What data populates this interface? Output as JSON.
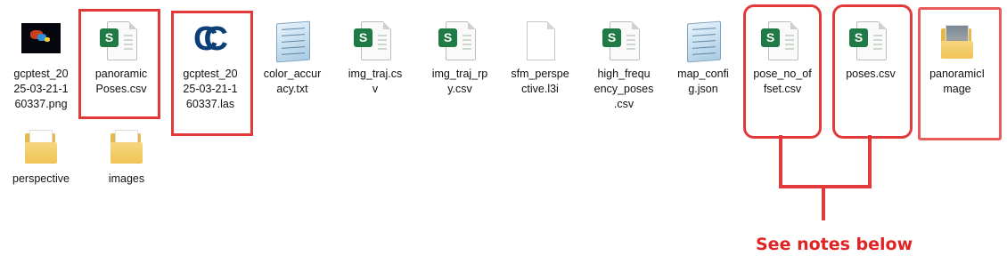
{
  "files": [
    {
      "name": "gcptest_2025-03-21-160337.png",
      "label_lines": [
        "gcptest_20",
        "25-03-21-1",
        "60337.png"
      ],
      "icon": "image-thumbnail-icon"
    },
    {
      "name": "panoramicPoses.csv",
      "label_lines": [
        "panoramic",
        "Poses.csv"
      ],
      "icon": "csv-icon"
    },
    {
      "name": "gcptest_2025-03-21-160337.las",
      "label_lines": [
        "gcptest_20",
        "25-03-21-1",
        "60337.las"
      ],
      "icon": "las-file-icon"
    },
    {
      "name": "color_accuracy.txt",
      "label_lines": [
        "color_accur",
        "acy.txt"
      ],
      "icon": "notepad-icon"
    },
    {
      "name": "img_traj.csv",
      "label_lines": [
        "img_traj.cs",
        "v"
      ],
      "icon": "csv-icon"
    },
    {
      "name": "img_traj_rpy.csv",
      "label_lines": [
        "img_traj_rp",
        "y.csv"
      ],
      "icon": "csv-icon"
    },
    {
      "name": "sfm_perspective.l3i",
      "label_lines": [
        "sfm_perspe",
        "ctive.l3i"
      ],
      "icon": "blank-file-icon"
    },
    {
      "name": "high_frequency_poses.csv",
      "label_lines": [
        "high_frequ",
        "ency_poses",
        ".csv"
      ],
      "icon": "csv-icon"
    },
    {
      "name": "map_config.json",
      "label_lines": [
        "map_confi",
        "g.json"
      ],
      "icon": "notepad-icon"
    },
    {
      "name": "pose_no_offset.csv",
      "label_lines": [
        "pose_no_of",
        "fset.csv"
      ],
      "icon": "csv-icon"
    },
    {
      "name": "poses.csv",
      "label_lines": [
        "poses.csv"
      ],
      "icon": "csv-icon"
    },
    {
      "name": "panoramicImage",
      "label_lines": [
        "panoramicI",
        "mage"
      ],
      "icon": "image-folder-icon"
    },
    {
      "name": "perspective",
      "label_lines": [
        "perspective"
      ],
      "icon": "folder-icon"
    },
    {
      "name": "images",
      "label_lines": [
        "images"
      ],
      "icon": "folder-icon"
    }
  ],
  "annotation": {
    "text": "See notes below",
    "color": "#e02424"
  },
  "csv_badge_letter": "S"
}
